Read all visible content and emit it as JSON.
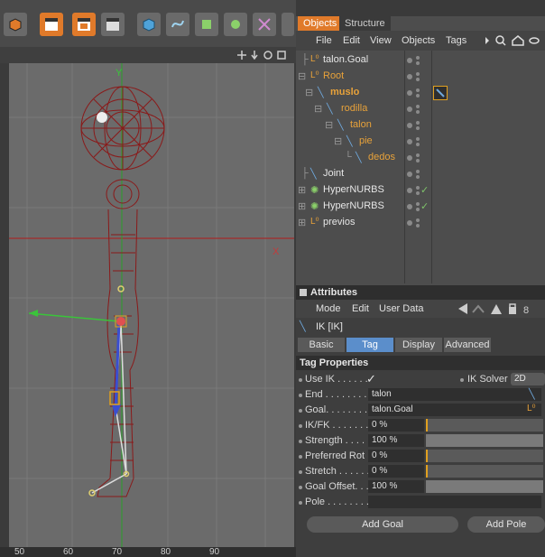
{
  "objects_panel": {
    "tabs": [
      "Objects",
      "Structure"
    ],
    "menu": [
      "File",
      "Edit",
      "View",
      "Objects",
      "Tags"
    ],
    "tree": [
      {
        "label": "talon.Goal",
        "kind": "null",
        "color": "white",
        "check": false
      },
      {
        "label": "Root",
        "kind": "null",
        "color": "orange",
        "check": false
      },
      {
        "label": "muslo",
        "kind": "joint",
        "color": "orange",
        "bold": true,
        "check": false
      },
      {
        "label": "rodilla",
        "kind": "joint",
        "color": "orange",
        "check": false
      },
      {
        "label": "talon",
        "kind": "joint",
        "color": "orange",
        "check": false
      },
      {
        "label": "pie",
        "kind": "joint",
        "color": "orange",
        "check": false
      },
      {
        "label": "dedos",
        "kind": "joint",
        "color": "orange",
        "check": false
      },
      {
        "label": "Joint",
        "kind": "joint",
        "color": "white",
        "check": false
      },
      {
        "label": "HyperNURBS",
        "kind": "hypernurbs",
        "color": "white",
        "check": true
      },
      {
        "label": "HyperNURBS",
        "kind": "hypernurbs",
        "color": "white",
        "check": true
      },
      {
        "label": "previos",
        "kind": "null",
        "color": "white",
        "check": false
      }
    ]
  },
  "attributes_panel": {
    "title": "Attributes",
    "menu": [
      "Mode",
      "Edit",
      "User Data"
    ],
    "tag_name": "IK [IK]",
    "tabs": [
      "Basic",
      "Tag",
      "Display",
      "Advanced"
    ],
    "active_tab": "Tag",
    "section": "Tag Properties",
    "use_ik_label": "Use IK . . . . . .",
    "use_ik_check": "✓",
    "ik_solver_label": "IK Solver",
    "ik_solver_value": "2D",
    "fields": [
      {
        "label": "End . . . . . . . . .",
        "value": "talon",
        "type": "link"
      },
      {
        "label": "Goal. . . . . . . . .",
        "value": "talon.Goal",
        "type": "link"
      },
      {
        "label": "IK/FK . . . . . . .",
        "value": "0 %",
        "type": "slider",
        "fraction": 0.0
      },
      {
        "label": "Strength . . . . .",
        "value": "100 %",
        "type": "slider",
        "fraction": 1.0
      },
      {
        "label": "Preferred Rot",
        "value": "0 %",
        "type": "slider",
        "fraction": 0.0
      },
      {
        "label": "Stretch . . . . . .",
        "value": "0 %",
        "type": "slider",
        "fraction": 0.0
      },
      {
        "label": "Goal Offset. . .",
        "value": "100 %",
        "type": "slider",
        "fraction": 1.0
      },
      {
        "label": "Pole . . . . . . . .",
        "value": "",
        "type": "link"
      }
    ],
    "buttons": [
      "Add Goal",
      "Add Pole"
    ]
  },
  "viewport": {
    "axis_x_label": "X",
    "axis_y_label": "Y",
    "ruler": [
      "50",
      "60",
      "70",
      "80",
      "90"
    ]
  },
  "colors": {
    "accent": "#e07a2a",
    "tab_selected": "#5b8ecb",
    "wireframe": "#8a1a1a",
    "check": "#7ec26a"
  }
}
